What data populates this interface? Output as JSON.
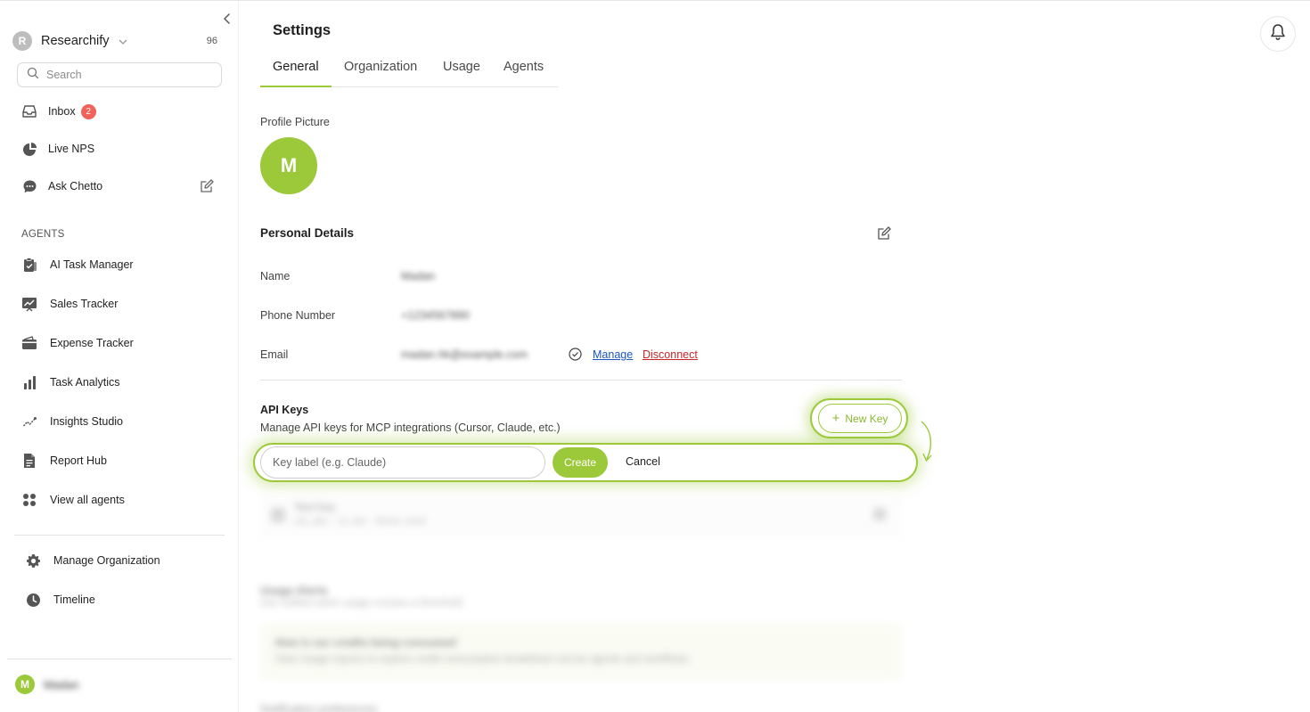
{
  "sidebar": {
    "workspace": {
      "initial": "R",
      "name": "Researchify",
      "count": "96"
    },
    "search_placeholder": "Search",
    "top_items": [
      {
        "label": "Inbox",
        "badge": "2"
      },
      {
        "label": "Live NPS"
      },
      {
        "label": "Ask Chetto"
      }
    ],
    "agents_label": "AGENTS",
    "agents": [
      {
        "label": "AI Task Manager"
      },
      {
        "label": "Sales Tracker"
      },
      {
        "label": "Expense Tracker"
      },
      {
        "label": "Task Analytics"
      },
      {
        "label": "Insights Studio"
      },
      {
        "label": "Report Hub"
      },
      {
        "label": "View all agents"
      }
    ],
    "bottom_items": [
      {
        "label": "Manage Organization"
      },
      {
        "label": "Timeline"
      }
    ],
    "user": {
      "initial": "M",
      "name": "Madan"
    }
  },
  "header": {
    "title": "Settings"
  },
  "tabs": [
    {
      "label": "General"
    },
    {
      "label": "Organization"
    },
    {
      "label": "Usage"
    },
    {
      "label": "Agents"
    }
  ],
  "profile": {
    "label": "Profile Picture",
    "initial": "M"
  },
  "personal": {
    "title": "Personal Details",
    "name_label": "Name",
    "name_value": "Madan",
    "phone_label": "Phone Number",
    "phone_value": "+1234567890",
    "email_label": "Email",
    "email_value": "madan.hk@example.com",
    "manage_label": "Manage",
    "disconnect_label": "Disconnect"
  },
  "api_keys": {
    "title": "API Keys",
    "description": "Manage API keys for MCP integrations (Cursor, Claude, etc.)",
    "new_key_label": "New Key",
    "input_placeholder": "Key label (e.g. Claude)",
    "create_label": "Create",
    "cancel_label": "Cancel",
    "existing_key": {
      "name": "Test Key",
      "meta": "rsk_abc · 12 Jan · Never used"
    }
  },
  "usage": {
    "title": "Usage Alerts",
    "description": "Get notified when usage crosses a threshold",
    "card_title": "How is our credits being consumed",
    "card_text": "View Usage reports to explore credit consumption breakdown across agents and workflows"
  },
  "bottom_peek": "Notification preferences",
  "colors": {
    "accent": "#9bc93a",
    "link": "#1a56c4",
    "danger": "#c62828",
    "badge": "#f0625a"
  }
}
